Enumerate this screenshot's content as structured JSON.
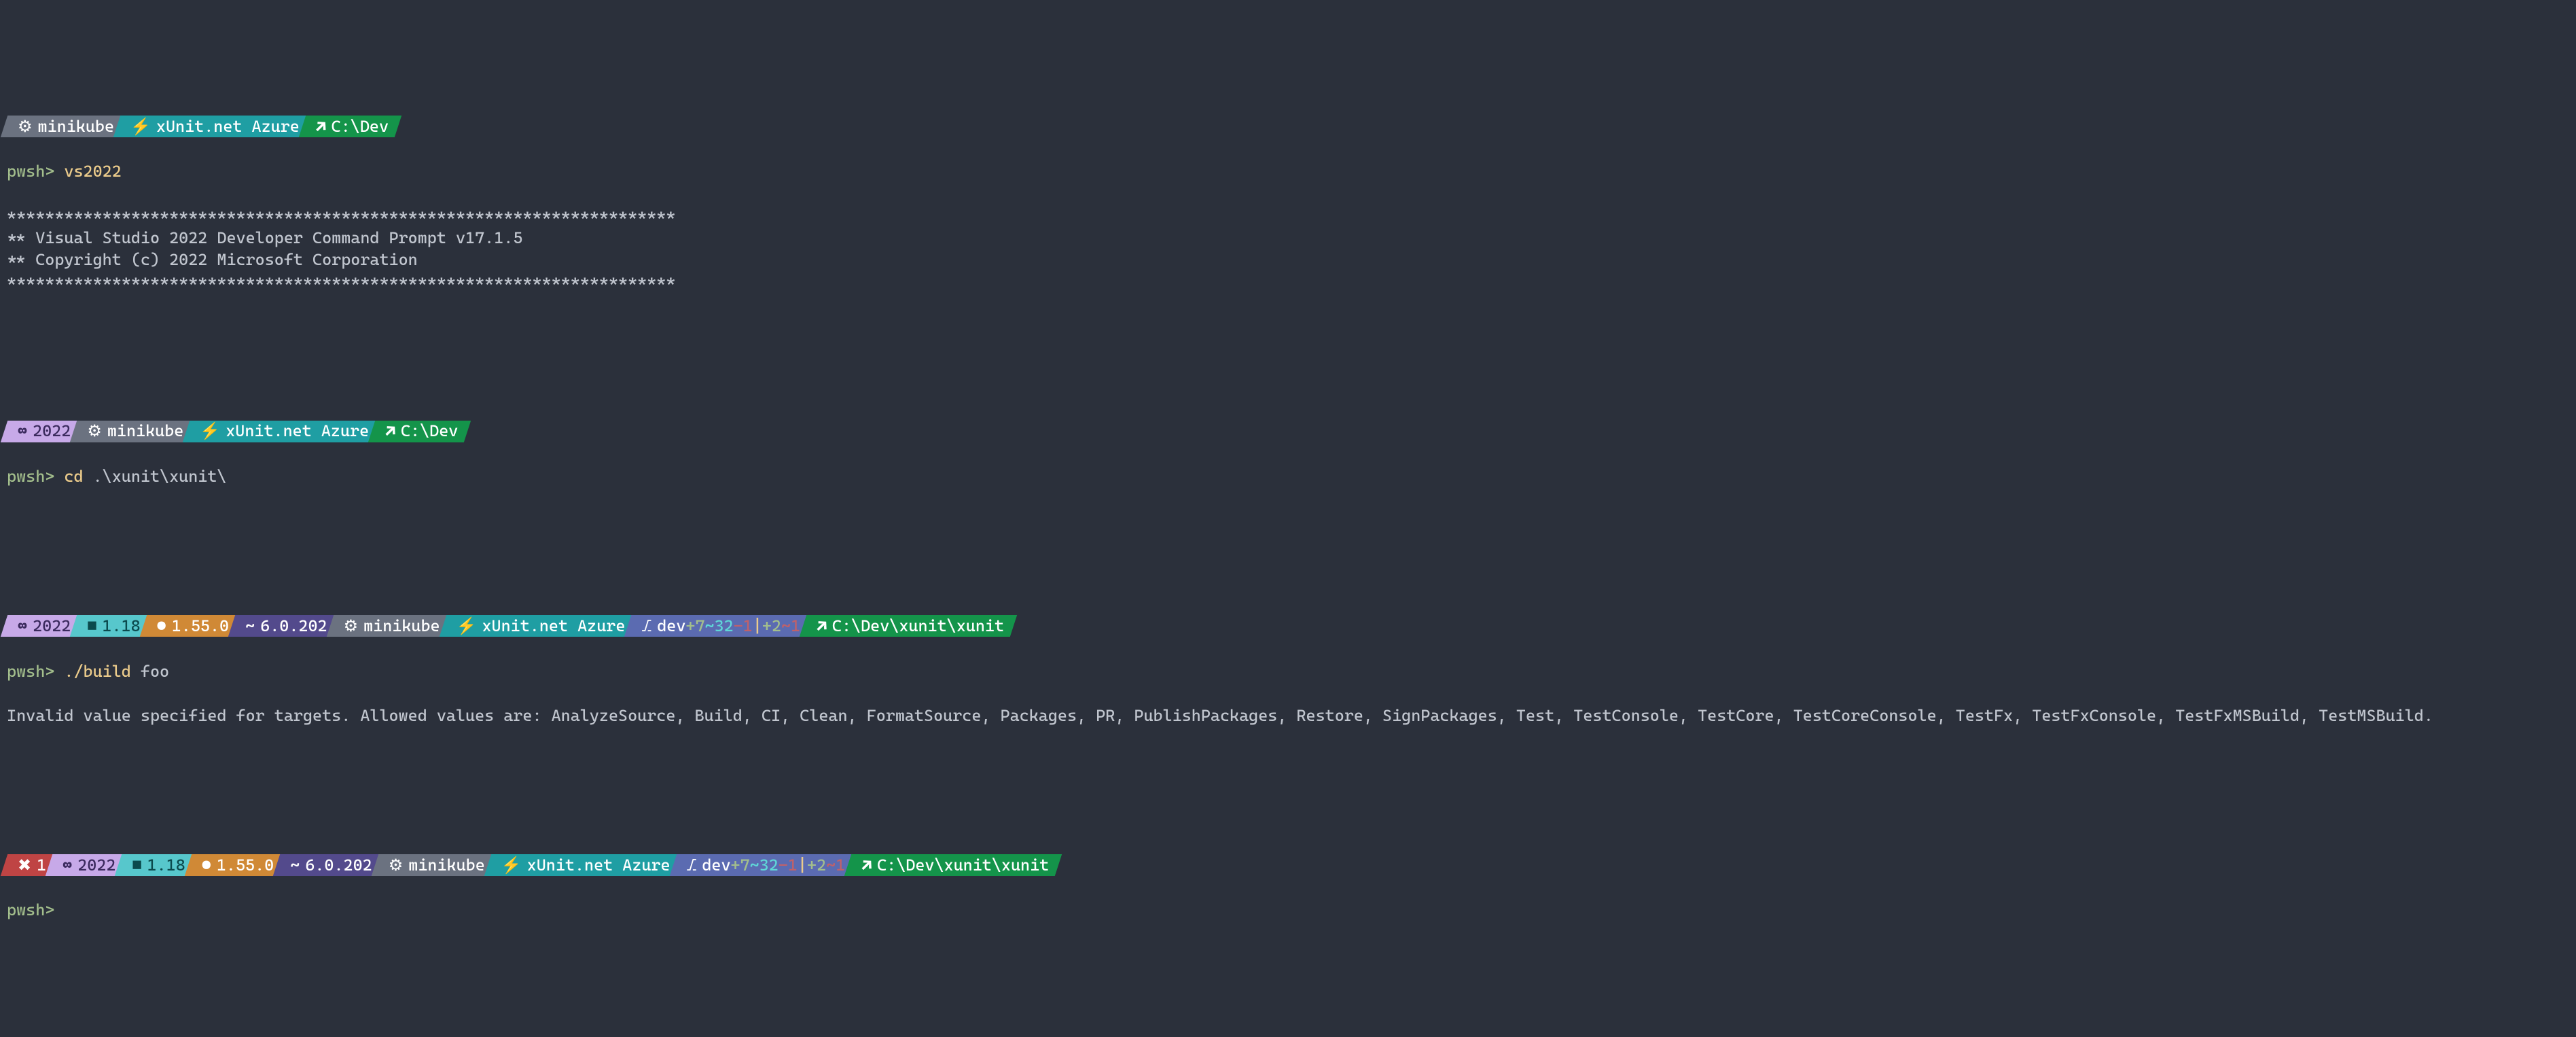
{
  "colors": {
    "gray": "#6b7280",
    "teal": "#1f9ea3",
    "green": "#14944a",
    "violet": "#c7a9e8",
    "cyan": "#57c7cc",
    "orange": "#d08936",
    "purple": "#534a8c",
    "indigo": "#5b6bb1",
    "red": "#bf4444"
  },
  "block1": {
    "segs": [
      {
        "icon": "gear",
        "text": "minikube",
        "bg": "gray"
      },
      {
        "icon": "bolt",
        "text": "xUnit.net Azure",
        "bg": "teal"
      },
      {
        "icon": "link",
        "text": "C:\\Dev",
        "bg": "green"
      }
    ],
    "cmd_prefix": "pwsh",
    "cmd": "vs2022",
    "output": [
      "**********************************************************************",
      "** Visual Studio 2022 Developer Command Prompt v17.1.5",
      "** Copyright (c) 2022 Microsoft Corporation",
      "**********************************************************************"
    ]
  },
  "block2": {
    "segs": [
      {
        "icon": "vs",
        "text": "2022",
        "bg": "violet",
        "fg": "#3b2a5e"
      },
      {
        "icon": "gear",
        "text": "minikube",
        "bg": "gray"
      },
      {
        "icon": "bolt",
        "text": "xUnit.net Azure",
        "bg": "teal"
      },
      {
        "icon": "link",
        "text": "C:\\Dev",
        "bg": "green"
      }
    ],
    "cmd_prefix": "pwsh",
    "cmd": "cd",
    "arg": ".\\xunit\\xunit\\"
  },
  "block3": {
    "segs": [
      {
        "icon": "vs",
        "text": "2022",
        "bg": "violet",
        "fg": "#3b2a5e"
      },
      {
        "icon": "box",
        "text": "1.18",
        "bg": "cyan",
        "fg": "#0b4a4d"
      },
      {
        "icon": "dot",
        "text": "1.55.0",
        "bg": "orange",
        "fg": "#fff"
      },
      {
        "icon": "tilde",
        "text": "6.0.202",
        "bg": "purple",
        "fg": "#fff"
      },
      {
        "icon": "gear",
        "text": "minikube",
        "bg": "gray"
      },
      {
        "icon": "bolt",
        "text": "xUnit.net Azure",
        "bg": "teal"
      },
      {
        "type": "git",
        "branch": "dev",
        "ahead": "+7",
        "behind": "~32",
        "del": "-1",
        "sep": "|",
        "stash": "+2",
        "mod": "~1",
        "bg": "indigo"
      },
      {
        "icon": "link",
        "text": "C:\\Dev\\xunit\\xunit",
        "bg": "green"
      }
    ],
    "cmd_prefix": "pwsh",
    "cmd": "./build",
    "arg": "foo",
    "output": "Invalid value specified for targets. Allowed values are: AnalyzeSource, Build, CI, Clean, FormatSource, Packages, PR, PublishPackages, Restore, SignPackages, Test, TestConsole, TestCore, TestCoreConsole, TestFx, TestFxConsole, TestFxMSBuild, TestMSBuild."
  },
  "block4": {
    "segs": [
      {
        "icon": "x",
        "text": "1",
        "bg": "red"
      },
      {
        "icon": "vs",
        "text": "2022",
        "bg": "violet",
        "fg": "#3b2a5e"
      },
      {
        "icon": "box",
        "text": "1.18",
        "bg": "cyan",
        "fg": "#0b4a4d"
      },
      {
        "icon": "dot",
        "text": "1.55.0",
        "bg": "orange",
        "fg": "#fff"
      },
      {
        "icon": "tilde",
        "text": "6.0.202",
        "bg": "purple",
        "fg": "#fff"
      },
      {
        "icon": "gear",
        "text": "minikube",
        "bg": "gray"
      },
      {
        "icon": "bolt",
        "text": "xUnit.net Azure",
        "bg": "teal"
      },
      {
        "type": "git",
        "branch": "dev",
        "ahead": "+7",
        "behind": "~32",
        "del": "-1",
        "sep": "|",
        "stash": "+2",
        "mod": "~1",
        "bg": "indigo"
      },
      {
        "icon": "link",
        "text": "C:\\Dev\\xunit\\xunit",
        "bg": "green"
      }
    ],
    "cmd_prefix": "pwsh"
  }
}
